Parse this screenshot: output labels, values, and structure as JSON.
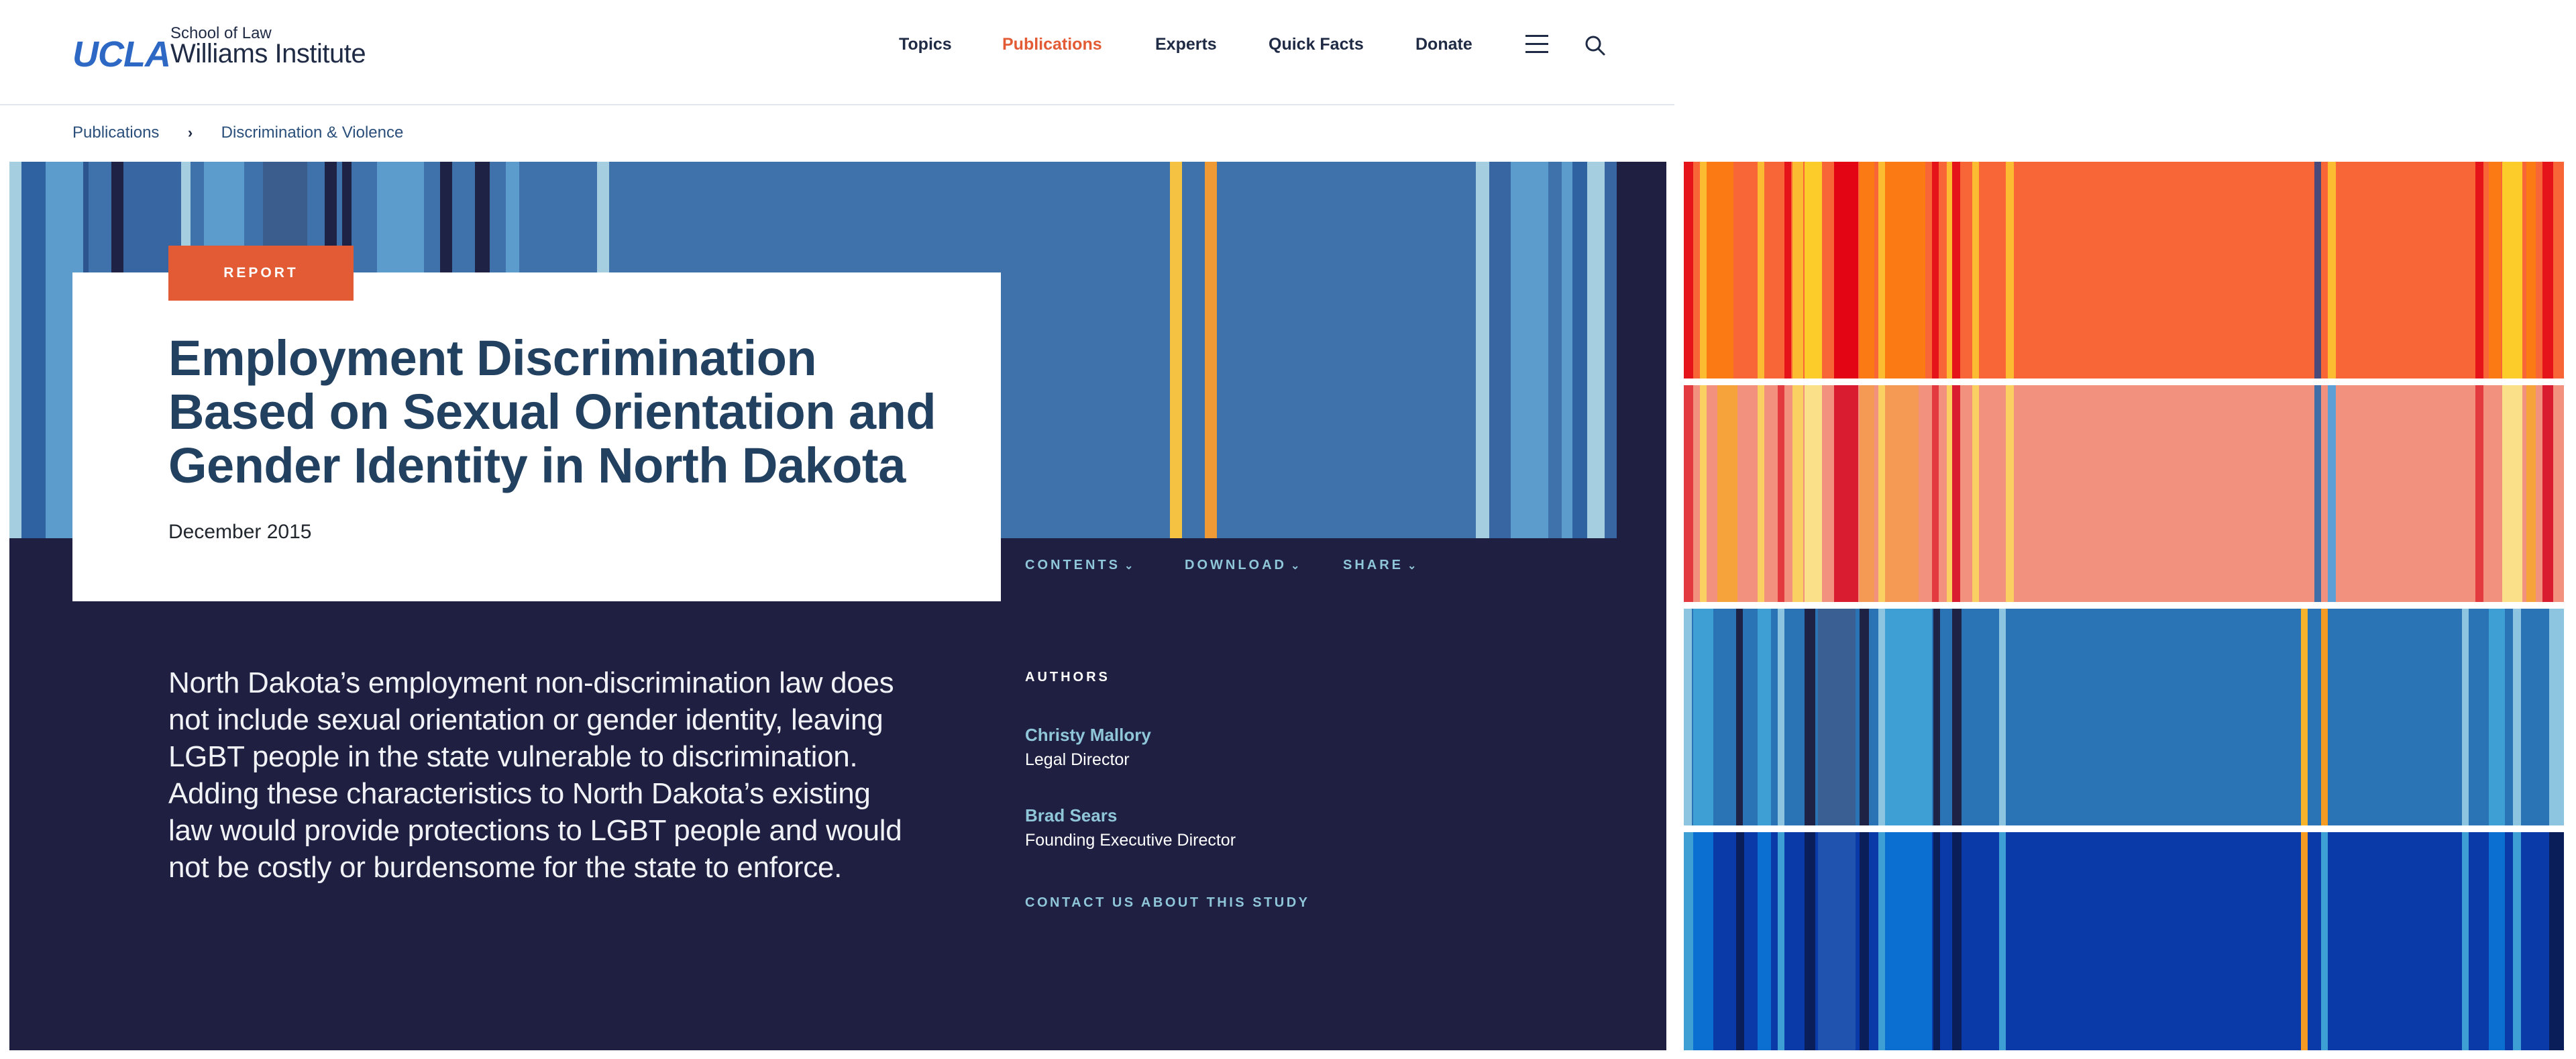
{
  "header": {
    "logo": {
      "ucla": "UCLA",
      "school": "School of Law",
      "institute": "Williams Institute"
    },
    "nav": [
      {
        "label": "Topics",
        "active": false
      },
      {
        "label": "Publications",
        "active": true
      },
      {
        "label": "Experts",
        "active": false
      },
      {
        "label": "Quick Facts",
        "active": false
      },
      {
        "label": "Donate",
        "active": false
      }
    ],
    "menu_icon": "hamburger-icon",
    "search_icon": "search-icon"
  },
  "breadcrumb": {
    "items": [
      "Publications",
      "Discrimination & Violence"
    ],
    "separator": "›"
  },
  "hero": {
    "badge": "REPORT",
    "title": "Employment Discrimination Based on Sexual Orientation and Gender Identity in North Dakota",
    "date": "December 2015"
  },
  "sub_nav": [
    {
      "label": "CONTENTS"
    },
    {
      "label": "DOWNLOAD"
    },
    {
      "label": "SHARE"
    }
  ],
  "summary": "North Dakota’s employment non-discrimination law does not include sexual orientation or gender identity, leaving LGBT people in the state vulnerable to discrimination. Adding these characteristics to North Dakota’s existing law would provide protections to LGBT people and would not be costly or burdensome for the state to enforce.",
  "authors": {
    "heading": "AUTHORS",
    "list": [
      {
        "name": "Christy Mallory",
        "role": "Legal Director"
      },
      {
        "name": "Brad Sears",
        "role": "Founding Executive Director"
      }
    ],
    "contact": "CONTACT US ABOUT THIS STUDY"
  },
  "colors": {
    "brand_blue": "#2d68c4",
    "navy": "#1f2041",
    "accent_orange": "#e35b34",
    "link_teal": "#8fc6d8",
    "title_blue": "#22405f"
  }
}
